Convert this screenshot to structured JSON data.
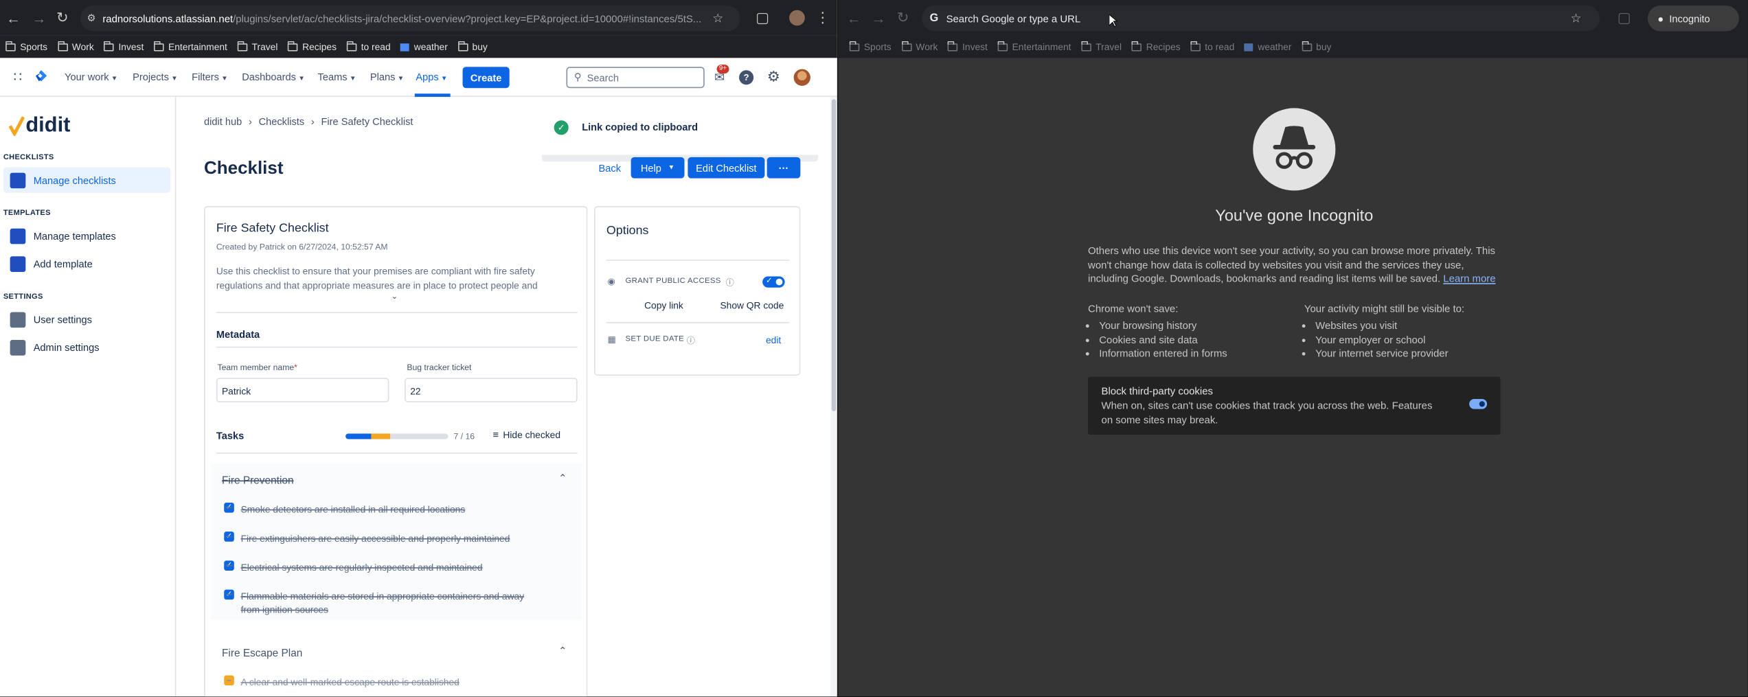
{
  "left_browser": {
    "url_host": "radnorsolutions.atlassian.net",
    "url_path": "/plugins/servlet/ac/checklists-jira/checklist-overview?project.key=EP&project.id=10000#!instances/5tS...",
    "bookmarks": [
      "Sports",
      "Work",
      "Invest",
      "Entertainment",
      "Travel",
      "Recipes",
      "to read",
      "weather",
      "buy"
    ]
  },
  "jira_header": {
    "nav": [
      "Your work",
      "Projects",
      "Filters",
      "Dashboards",
      "Teams",
      "Plans",
      "Apps"
    ],
    "create_label": "Create",
    "search_placeholder": "Search",
    "notif_badge": "9+"
  },
  "sidebar": {
    "logo_text": "didit",
    "sections": [
      {
        "heading": "CHECKLISTS",
        "items": [
          "Manage checklists"
        ]
      },
      {
        "heading": "TEMPLATES",
        "items": [
          "Manage templates",
          "Add template"
        ]
      },
      {
        "heading": "SETTINGS",
        "items": [
          "User settings",
          "Admin settings"
        ]
      }
    ]
  },
  "main": {
    "breadcrumb": [
      "didit hub",
      "Checklists",
      "Fire Safety Checklist"
    ],
    "toast": "Link copied to clipboard",
    "page_title": "Checklist",
    "back_label": "Back",
    "help_label": "Help",
    "edit_label": "Edit Checklist",
    "more_label": "···",
    "checklist": {
      "title": "Fire Safety Checklist",
      "created": "Created by Patrick on 6/27/2024, 10:52:57 AM",
      "description": "Use this checklist to ensure that your premises are compliant with fire safety regulations and that appropriate measures are in place to protect people and",
      "metadata_heading": "Metadata",
      "fields": [
        {
          "label": "Team member name",
          "required": "*",
          "value": "Patrick"
        },
        {
          "label": "Bug tracker ticket",
          "value": "22"
        }
      ],
      "tasks_heading": "Tasks",
      "progress_text": "7 / 16",
      "progress": {
        "done": 0.25,
        "partial": 0.19
      },
      "hide_checked_label": "Hide checked",
      "groups": [
        {
          "name": "Fire Prevention",
          "tasks": [
            "Smoke detectors are installed in all required locations",
            "Fire extinguishers are easily accessible and properly maintained",
            "Electrical systems are regularly inspected and maintained",
            "Flammable materials are stored in appropriate containers and away from ignition sources"
          ]
        },
        {
          "name": "Fire Escape Plan",
          "tasks": [
            "A clear and well-marked escape route is established"
          ]
        }
      ]
    },
    "options": {
      "title": "Options",
      "public_access_label": "GRANT PUBLIC ACCESS",
      "copy_link_label": "Copy link",
      "qr_label": "Show QR code",
      "due_date_label": "SET DUE DATE",
      "edit_label": "edit"
    }
  },
  "right_browser": {
    "omnibox_placeholder": "Search Google or type a URL",
    "profile_label": "Incognito",
    "bookmarks": [
      "Sports",
      "Work",
      "Invest",
      "Entertainment",
      "Travel",
      "Recipes",
      "to read",
      "weather",
      "buy"
    ],
    "incognito": {
      "heading": "You've gone Incognito",
      "paragraph": "Others who use this device won't see your activity, so you can browse more privately. This won't change how data is collected by websites you visit and the services they use, including Google. Downloads, bookmarks and reading list items will be saved.",
      "learn_more": "Learn more",
      "wont_save_heading": "Chrome won't save:",
      "wont_save": [
        "Your browsing history",
        "Cookies and site data",
        "Information entered in forms"
      ],
      "visible_heading": "Your activity might still be visible to:",
      "visible": [
        "Websites you visit",
        "Your employer or school",
        "Your internet service provider"
      ],
      "cookies_title": "Block third-party cookies",
      "cookies_text": "When on, sites can't use cookies that track you across the web. Features on some sites may break."
    }
  }
}
